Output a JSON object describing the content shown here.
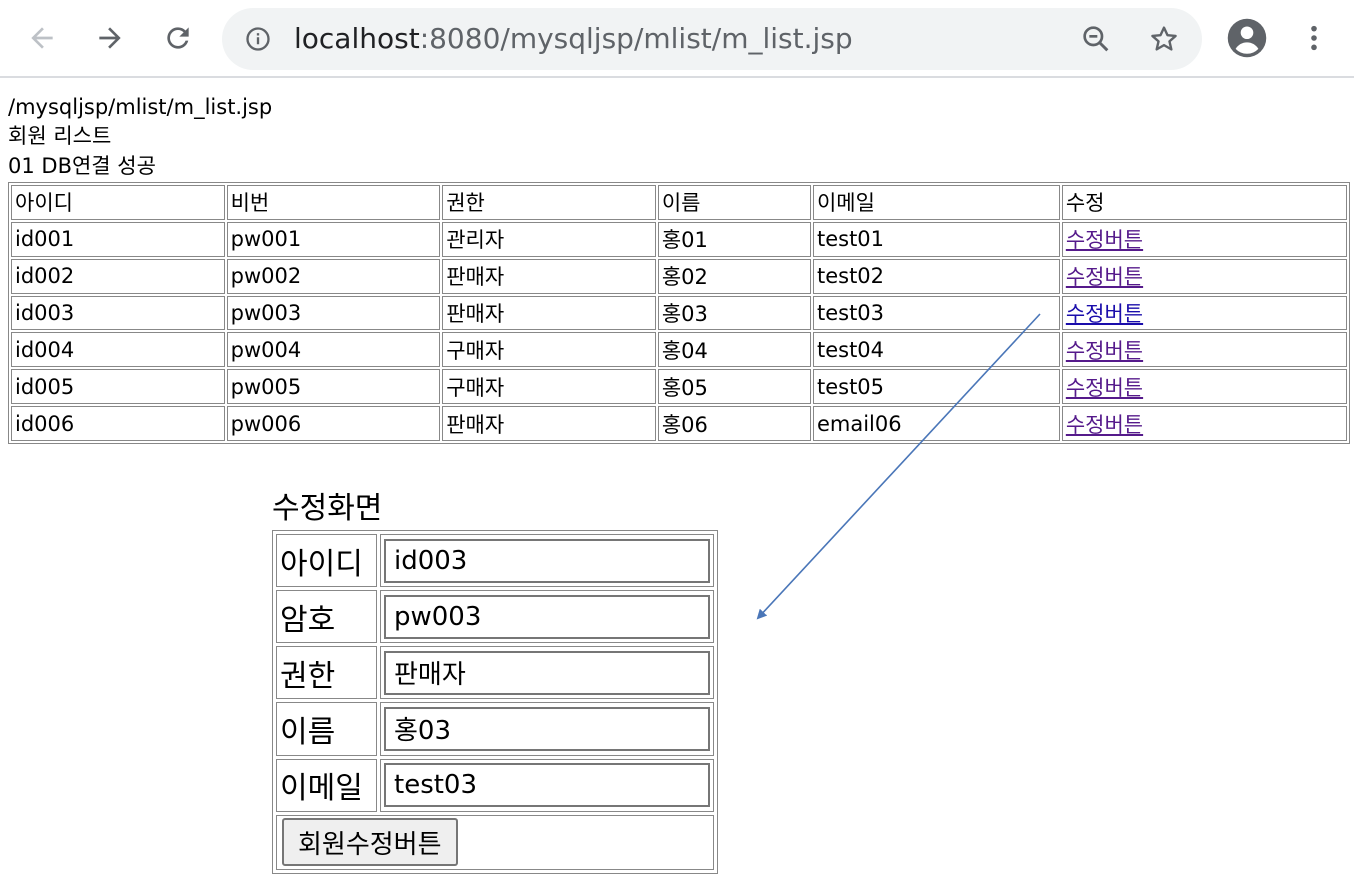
{
  "browser": {
    "url_host": "localhost",
    "url_rest": ":8080/mysqljsp/mlist/m_list.jsp",
    "icons": [
      "back-arrow-icon",
      "forward-arrow-icon",
      "reload-icon",
      "info-icon",
      "zoom-out-icon",
      "star-icon",
      "account-icon",
      "more-vert-icon"
    ]
  },
  "page": {
    "path_line": "/mysqljsp/mlist/m_list.jsp",
    "heading": "회원 리스트",
    "db_status": "01 DB연결 성공"
  },
  "member_table": {
    "headers": [
      "아이디",
      "비번",
      "권한",
      "이름",
      "이메일",
      "수정"
    ],
    "rows": [
      {
        "id": "id001",
        "pw": "pw001",
        "role": "관리자",
        "name": "홍01",
        "email": "test01",
        "action": "수정버튼"
      },
      {
        "id": "id002",
        "pw": "pw002",
        "role": "판매자",
        "name": "홍02",
        "email": "test02",
        "action": "수정버튼"
      },
      {
        "id": "id003",
        "pw": "pw003",
        "role": "판매자",
        "name": "홍03",
        "email": "test03",
        "action": "수정버튼"
      },
      {
        "id": "id004",
        "pw": "pw004",
        "role": "구매자",
        "name": "홍04",
        "email": "test04",
        "action": "수정버튼"
      },
      {
        "id": "id005",
        "pw": "pw005",
        "role": "구매자",
        "name": "홍05",
        "email": "test05",
        "action": "수정버튼"
      },
      {
        "id": "id006",
        "pw": "pw006",
        "role": "판매자",
        "name": "홍06",
        "email": "email06",
        "action": "수정버튼"
      }
    ]
  },
  "edit_form": {
    "title": "수정화면",
    "fields": [
      {
        "label": "아이디",
        "value": "id003"
      },
      {
        "label": "암호",
        "value": "pw003"
      },
      {
        "label": "권한",
        "value": "판매자"
      },
      {
        "label": "이름",
        "value": "홍03"
      },
      {
        "label": "이메일",
        "value": "test03"
      }
    ],
    "submit_label": "회원수정버튼"
  },
  "colors": {
    "visited_link": "#551a8b",
    "link": "#1a0dab",
    "arrow": "#4a76b8",
    "omnibox_bg": "#f1f3f4",
    "icon": "#5f6368"
  }
}
